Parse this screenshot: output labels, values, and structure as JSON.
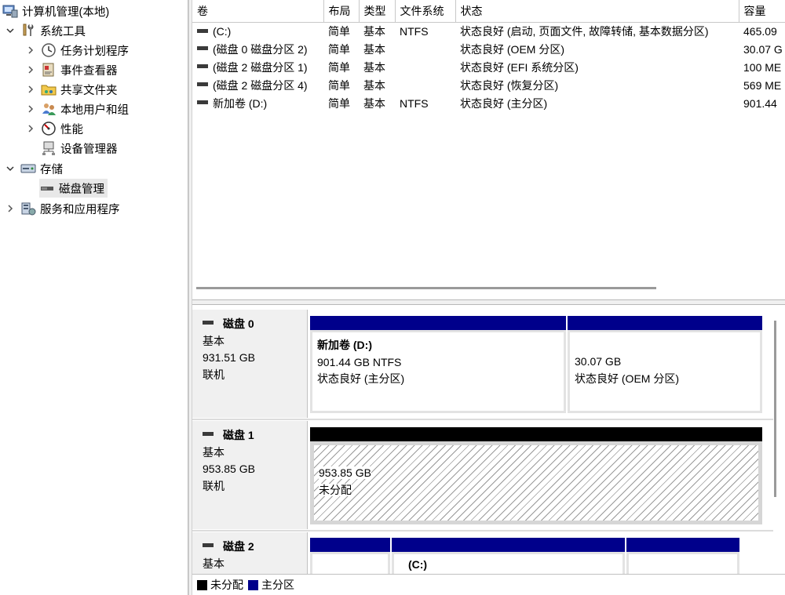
{
  "tree": {
    "root": "计算机管理(本地)",
    "system_tools": "系统工具",
    "task_scheduler": "任务计划程序",
    "event_viewer": "事件查看器",
    "shared_folders": "共享文件夹",
    "local_users": "本地用户和组",
    "performance": "性能",
    "device_manager": "设备管理器",
    "storage": "存储",
    "disk_management": "磁盘管理",
    "services_apps": "服务和应用程序"
  },
  "list": {
    "columns": [
      "卷",
      "布局",
      "类型",
      "文件系统",
      "状态",
      "容量"
    ],
    "rows": [
      {
        "volume": "(C:)",
        "layout": "简单",
        "type": "基本",
        "fs": "NTFS",
        "status": "状态良好 (启动, 页面文件, 故障转储, 基本数据分区)",
        "capacity": "465.09"
      },
      {
        "volume": "(磁盘 0 磁盘分区 2)",
        "layout": "简单",
        "type": "基本",
        "fs": "",
        "status": "状态良好 (OEM 分区)",
        "capacity": "30.07 G"
      },
      {
        "volume": "(磁盘 2 磁盘分区 1)",
        "layout": "简单",
        "type": "基本",
        "fs": "",
        "status": "状态良好 (EFI 系统分区)",
        "capacity": "100 ME"
      },
      {
        "volume": "(磁盘 2 磁盘分区 4)",
        "layout": "简单",
        "type": "基本",
        "fs": "",
        "status": "状态良好 (恢复分区)",
        "capacity": "569 ME"
      },
      {
        "volume": "新加卷 (D:)",
        "layout": "简单",
        "type": "基本",
        "fs": "NTFS",
        "status": "状态良好 (主分区)",
        "capacity": "901.44"
      }
    ]
  },
  "disks": {
    "disk0": {
      "name": "磁盘 0",
      "type": "基本",
      "size": "931.51 GB",
      "state": "联机",
      "p1": {
        "name": "新加卷  (D:)",
        "size": "901.44 GB NTFS",
        "status": "状态良好 (主分区)"
      },
      "p2": {
        "size": "30.07 GB",
        "status": "状态良好 (OEM 分区)"
      }
    },
    "disk1": {
      "name": "磁盘 1",
      "type": "基本",
      "size": "953.85 GB",
      "state": "联机",
      "p1": {
        "size": "953.85 GB",
        "status": "未分配"
      }
    },
    "disk2": {
      "name": "磁盘 2",
      "type": "基本",
      "p2": {
        "name": "(C:)"
      }
    }
  },
  "legend": {
    "unallocated": "未分配",
    "primary": "主分区"
  },
  "colors": {
    "primary": "#00008b",
    "unallocated": "#000000"
  }
}
